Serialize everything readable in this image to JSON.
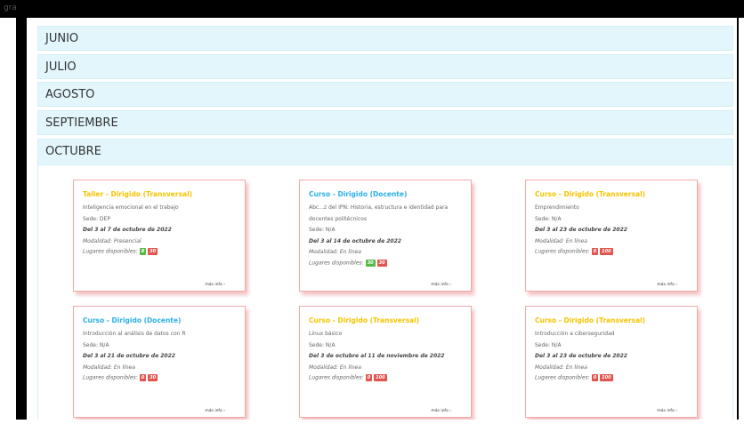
{
  "browser": {
    "tab_text": "graneo.com"
  },
  "accordion": [
    {
      "label": "JUNIO"
    },
    {
      "label": "JULIO"
    },
    {
      "label": "AGOSTO"
    },
    {
      "label": "SEPTIEMBRE"
    },
    {
      "label": "OCTUBRE"
    }
  ],
  "colors": {
    "title_yellow": "#f5c400",
    "title_blue": "#2bb0e6",
    "badge_green": "#58b947",
    "badge_red": "#e0554f"
  },
  "cards": [
    {
      "title": "Taller - Dirigido (Transversal)",
      "title_color": "yellow",
      "lines": [
        "Inteligencia emocional en el trabajo",
        "Sede: DEP",
        "Del 3 al 7 de octubre de 2022",
        "Modalidad: Presencial"
      ],
      "lugares_label": "Lugares disponibles:",
      "badge1": "8",
      "badge1_color": "green",
      "badge2": "30",
      "more": "más info ›"
    },
    {
      "title": "Curso - Dirigido (Docente)",
      "title_color": "blue",
      "lines": [
        "Abc...z del IPN: Historia, estructura e identidad para",
        "docentes politécnicos",
        "Sede: N/A",
        "Del 3 al 14 de octubre de 2022",
        "Modalidad: En línea"
      ],
      "lugares_label": "Lugares disponibles:",
      "badge1": "30",
      "badge1_color": "green",
      "badge2": "30",
      "more": "más info ›"
    },
    {
      "title": "Curso - Dirigido (Transversal)",
      "title_color": "yellow",
      "lines": [
        "Emprendimiento",
        "Sede: N/A",
        "Del 3 al 23 de octubre de 2022",
        "Modalidad: En línea"
      ],
      "lugares_label": "Lugares disponibles:",
      "badge1": "0",
      "badge1_color": "red",
      "badge2": "100",
      "more": "más info ›"
    },
    {
      "title": "Curso - Dirigido (Docente)",
      "title_color": "blue",
      "lines": [
        "Introducción al análisis de datos con R",
        "Sede: N/A",
        "Del 3 al 21 de octubre de 2022",
        "Modalidad: En línea"
      ],
      "lugares_label": "Lugares disponibles:",
      "badge1": "0",
      "badge1_color": "red",
      "badge2": "30",
      "more": "más info ›"
    },
    {
      "title": "Curso - Dirigido (Transversal)",
      "title_color": "yellow",
      "lines": [
        "Linux básico",
        "Sede: N/A",
        "Del 3 de octubre al 11 de noviembre de 2022",
        "Modalidad: En línea"
      ],
      "lugares_label": "Lugares disponibles:",
      "badge1": "0",
      "badge1_color": "red",
      "badge2": "100",
      "more": "más info ›"
    },
    {
      "title": "Curso - Dirigido (Transversal)",
      "title_color": "yellow",
      "lines": [
        "Introducción a ciberseguridad",
        "Sede: N/A",
        "Del 3 al 23 de octubre de 2022",
        "Modalidad: En línea"
      ],
      "lugares_label": "Lugares disponibles:",
      "badge1": "0",
      "badge1_color": "red",
      "badge2": "100",
      "more": "más info ›"
    }
  ]
}
